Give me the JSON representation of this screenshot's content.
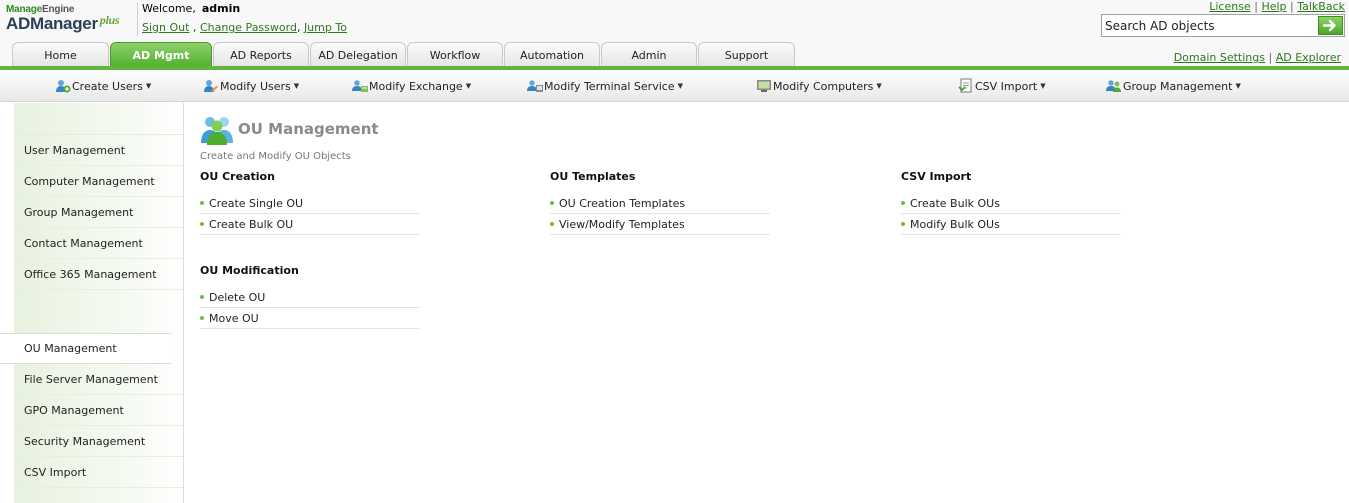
{
  "logo": {
    "line1a": "Manage",
    "line1b": "Engine",
    "line2": "ADManager",
    "plus": "plus"
  },
  "header": {
    "welcome_label": "Welcome,",
    "username": "admin",
    "links": [
      "Sign Out",
      "Change Password",
      "Jump To"
    ],
    "right_links": [
      "License",
      "Help",
      "TalkBack"
    ],
    "search_placeholder": "Search AD objects",
    "secondary_links": [
      "Domain Settings",
      "AD Explorer"
    ]
  },
  "tabs": [
    {
      "label": "Home",
      "active": false
    },
    {
      "label": "AD Mgmt",
      "active": true
    },
    {
      "label": "AD Reports",
      "active": false
    },
    {
      "label": "AD Delegation",
      "active": false
    },
    {
      "label": "Workflow",
      "active": false
    },
    {
      "label": "Automation",
      "active": false
    },
    {
      "label": "Admin",
      "active": false
    },
    {
      "label": "Support",
      "active": false
    }
  ],
  "submenu": [
    {
      "label": "Create Users",
      "icon": "create-users-icon"
    },
    {
      "label": "Modify Users",
      "icon": "modify-users-icon"
    },
    {
      "label": "Modify Exchange",
      "icon": "modify-exchange-icon"
    },
    {
      "label": "Modify Terminal Service",
      "icon": "terminal-service-icon"
    },
    {
      "label": "Modify Computers",
      "icon": "computer-icon"
    },
    {
      "label": "CSV Import",
      "icon": "csv-import-icon"
    },
    {
      "label": "Group Management",
      "icon": "group-icon"
    }
  ],
  "sidebar": {
    "items_top": [
      "User Management",
      "Computer Management",
      "Group Management",
      "Contact Management",
      "Office 365 Management"
    ],
    "active": "OU Management",
    "items_bottom": [
      "File Server Management",
      "GPO Management",
      "Security Management",
      "CSV Import"
    ]
  },
  "page": {
    "title": "OU Management",
    "subtitle": "Create and Modify OU Objects"
  },
  "sections": [
    {
      "title": "OU Creation",
      "links": [
        "Create Single OU",
        "Create Bulk OU"
      ]
    },
    {
      "title": "OU Templates",
      "links": [
        "OU Creation Templates",
        "View/Modify Templates"
      ]
    },
    {
      "title": "CSV Import",
      "links": [
        "Create Bulk OUs",
        "Modify Bulk OUs"
      ]
    },
    {
      "title": "OU Modification",
      "links": [
        "Delete OU",
        "Move OU"
      ]
    }
  ],
  "colors": {
    "accent_green": "#4fae2d",
    "link_green": "#2c7a1c",
    "bar_green": "#63b63d"
  }
}
